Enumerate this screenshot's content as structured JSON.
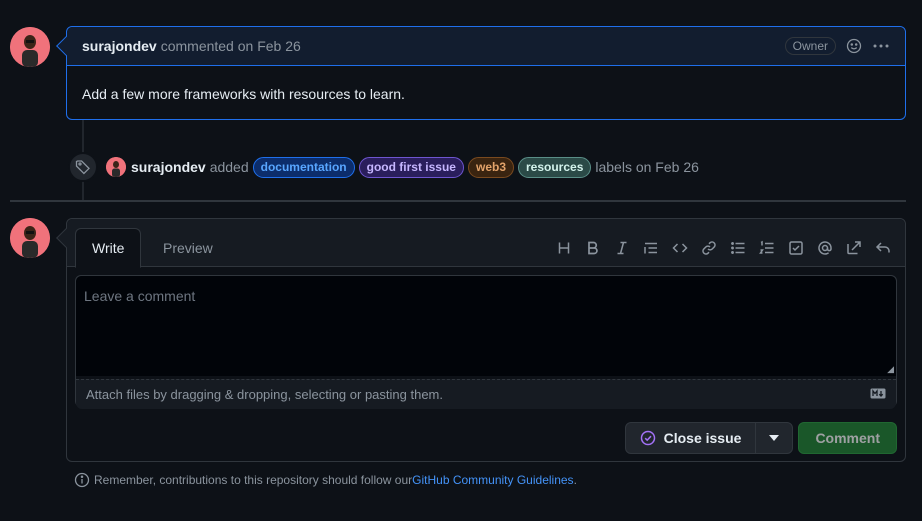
{
  "comment": {
    "author": "surajondev",
    "meta": "commented on Feb 26",
    "badge": "Owner",
    "body": "Add a few more frameworks with resources to learn."
  },
  "label_event": {
    "author": "surajondev",
    "action": "added",
    "labels": [
      {
        "name": "documentation",
        "color": "#58a6ff",
        "bg": "#0c2d6b",
        "border": "#1f6feb"
      },
      {
        "name": "good first issue",
        "color": "#c6b6ff",
        "bg": "#2a1e5c",
        "border": "#6e55d0"
      },
      {
        "name": "web3",
        "color": "#e3a36a",
        "bg": "#3a2410",
        "border": "#7a4a1f"
      },
      {
        "name": "resources",
        "color": "#d4f3ec",
        "bg": "#2b4a47",
        "border": "#5a8e87"
      }
    ],
    "tail": "labels on Feb 26"
  },
  "composer": {
    "tab_write": "Write",
    "tab_preview": "Preview",
    "placeholder": "Leave a comment",
    "attach_text": "Attach files by dragging & dropping, selecting or pasting them.",
    "close_label": "Close issue",
    "comment_label": "Comment"
  },
  "reminder": {
    "prefix": "Remember, contributions to this repository should follow our ",
    "link": "GitHub Community Guidelines",
    "suffix": "."
  },
  "colors": {
    "accent": "#1f6feb",
    "comment_button": "#238636",
    "close_icon": "#a371f7"
  }
}
